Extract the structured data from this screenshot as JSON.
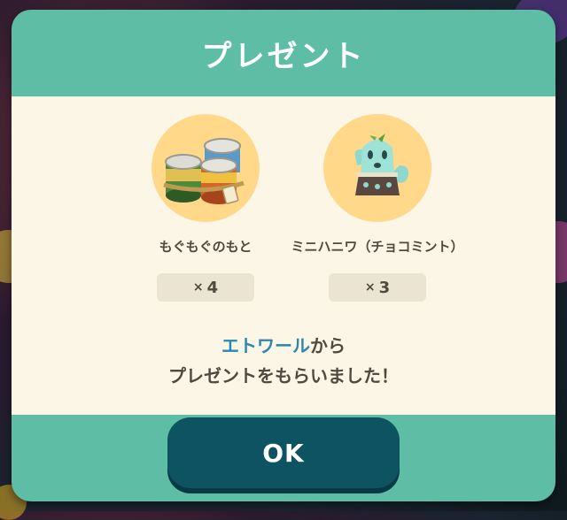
{
  "dialog": {
    "title": "プレゼント",
    "items": [
      {
        "name": "もぐもぐのもと",
        "qty_symbol": "×",
        "qty": "4",
        "icon": "canned-food-icon"
      },
      {
        "name": "ミニハニワ（チョコミント）",
        "qty_symbol": "×",
        "qty": "3",
        "icon": "mini-haniwa-icon"
      }
    ],
    "message": {
      "sender": "エトワール",
      "sender_suffix": "から",
      "line2": "プレゼントをもらいました！"
    },
    "ok_label": "OK"
  },
  "colors": {
    "frame": "#5dbea5",
    "content_bg": "#fcf6e6",
    "item_circle": "#ffd88a",
    "qty_bg": "#ece4d2",
    "sender_text": "#2a88b0",
    "button": "#0d5361"
  }
}
